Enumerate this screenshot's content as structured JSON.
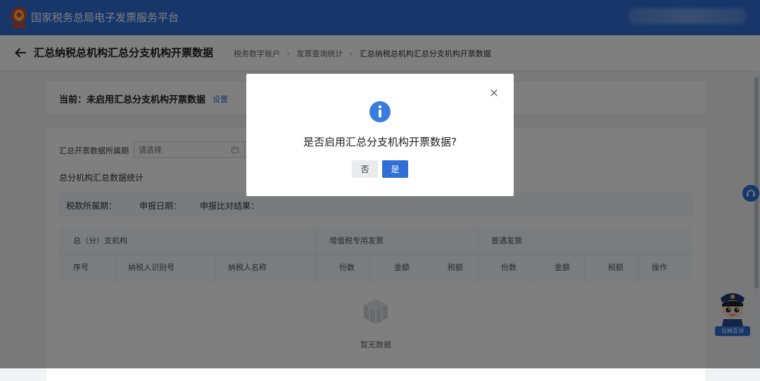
{
  "header": {
    "app_title": "国家税务总局电子发票服务平台",
    "emblem_icon": "tax-emblem-icon",
    "brand_color": "#2f6fd6"
  },
  "subheader": {
    "title": "汇总纳税总机构汇总分支机构开票数据",
    "breadcrumb": [
      "税务数字账户",
      "发票查询统计",
      "汇总纳税总机构汇总分支机构开票数据"
    ]
  },
  "status_card": {
    "current_label": "当前：未启用汇总分支机构开票数据",
    "setup_link": "设置"
  },
  "filter": {
    "period_label": "汇总开票数据所属期",
    "period_placeholder": "请选择"
  },
  "stats": {
    "section_title": "总分机构汇总数据统计",
    "tax_period_label": "税款所属期：",
    "declare_date_label": "申报日期：",
    "compare_result_label": "申报比对结果："
  },
  "table": {
    "group_headers": [
      "总（分）支机构",
      "增值税专用发票",
      "普通发票"
    ],
    "columns": [
      "序号",
      "纳税人识别号",
      "纳税人名称",
      "份数",
      "金额",
      "税额",
      "份数",
      "金额",
      "税额",
      "操作"
    ],
    "empty_text": "暂无数据"
  },
  "assistant": {
    "label": "征纳互动"
  },
  "dialog": {
    "message": "是否启用汇总分支机构开票数据?",
    "no_label": "否",
    "yes_label": "是",
    "info_color": "#3a7be0"
  }
}
